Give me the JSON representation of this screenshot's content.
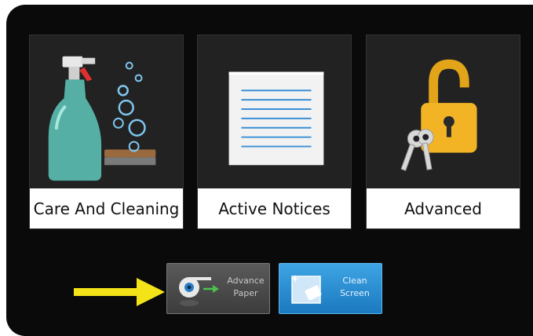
{
  "tiles": [
    {
      "label": "Care And Cleaning",
      "icon": "spray-bottle-icon"
    },
    {
      "label": "Active Notices",
      "icon": "document-icon"
    },
    {
      "label": "Advanced",
      "icon": "padlock-keys-icon"
    }
  ],
  "buttons": {
    "advance_paper": {
      "line1": "Advance",
      "line2": "Paper",
      "icon": "paper-roll-icon"
    },
    "clean_screen": {
      "line1": "Clean",
      "line2": "Screen",
      "icon": "clean-screen-icon"
    }
  },
  "colors": {
    "pointer_arrow": "#f5e31a",
    "clean_button": "#2a8fd6",
    "lock": "#f0b020"
  }
}
